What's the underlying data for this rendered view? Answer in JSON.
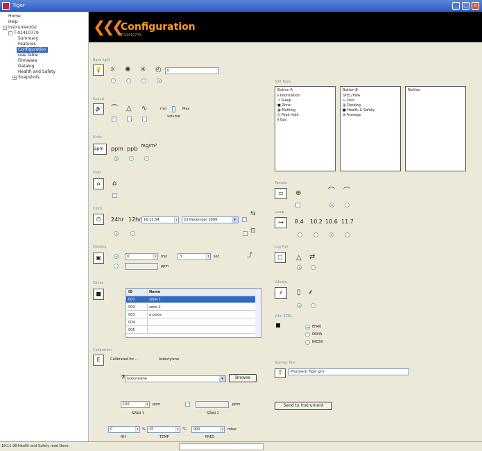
{
  "window": {
    "title": "Tiger",
    "min": "_",
    "max": "□",
    "close": "×"
  },
  "tree": {
    "home": "Home",
    "help": "Help",
    "instruments": "Instrument(s)",
    "instrument": "T-01410779",
    "items": [
      "Summary",
      "Features",
      "Configuration",
      "Gas Table",
      "Firmware",
      "Datalog",
      "Health and Safety",
      "Snapshots"
    ]
  },
  "header": {
    "title": "Configuration",
    "subtitle": "T-01410779"
  },
  "backlight": {
    "label": "Back light",
    "timeout": "0",
    "radios": [
      false,
      false,
      false,
      true
    ]
  },
  "sound": {
    "label": "Sound",
    "checks": [
      true,
      false,
      false
    ],
    "min": "min",
    "max": "Max",
    "volume": "volume"
  },
  "units": {
    "label": "Units",
    "options": [
      "ppm",
      "ppm",
      "ppb",
      "mg/m³"
    ],
    "radios": [
      true,
      false,
      false
    ]
  },
  "hold": {
    "label": "Hold"
  },
  "clock": {
    "label": "Clock",
    "h24": "24hr",
    "h12": "12hr",
    "time": "16:11:54",
    "date": "23 December 2009",
    "radios": [
      true,
      false
    ]
  },
  "datalog": {
    "label": "Datalog",
    "value": "0",
    "min": "min",
    "sec_value": "3",
    "sec": "sec",
    "ppm": "ppm"
  },
  "zones": {
    "label": "Zones",
    "col_id": "ID",
    "col_name": "Name",
    "rows": [
      {
        "id": "001",
        "name": "zone 1"
      },
      {
        "id": "002",
        "name": "zone 2"
      },
      {
        "id": "003",
        "name": "a place"
      },
      {
        "id": "004",
        "name": ""
      },
      {
        "id": "005",
        "name": ""
      }
    ]
  },
  "calibration": {
    "label": "Calibration",
    "calibrated_for": "Calibrated for ...",
    "gas": "Isobutylene",
    "gas_select": "Isobutylene",
    "browse": "Browse",
    "span1": "100",
    "span1_unit": "ppm",
    "span1_label": "SPAN 1",
    "span2_unit": "ppm",
    "span2_label": "SPAN 2",
    "rh": "0",
    "rh_unit": "%",
    "rh_label": "RH",
    "temp": "25",
    "temp_unit": "°C",
    "temp_label": "TEMP",
    "pres": "900",
    "pres_unit": "mbar",
    "pres_label": "PRES"
  },
  "softkeys": {
    "label": "Soft Keys",
    "col_a": "Button A",
    "col_b": "Button B",
    "col_n": "Neither",
    "a_items": [
      "Information",
      "Sleep",
      "Zone",
      "Multilog",
      "Peak Hold",
      "Gas"
    ],
    "b_items": [
      "STEL/TWA",
      "Zero",
      "Datalog",
      "Health & Safety",
      "Average"
    ]
  },
  "tamper": {
    "label": "Tamper",
    "radios": [
      true,
      false
    ]
  },
  "lamp": {
    "label": "Lamp",
    "values": [
      "8.4",
      "10.2",
      "10.6",
      "11.7"
    ],
    "radios": [
      false,
      false,
      true,
      false
    ]
  },
  "logfull": {
    "label": "Log Full",
    "radios": [
      true,
      false
    ]
  },
  "vibrate": {
    "label": "Vibrate",
    "radios": [
      true,
      false
    ]
  },
  "voc": {
    "label": "Vibr. STEL",
    "options": [
      "EH40",
      "OSHA",
      "NIOSH"
    ],
    "radios": [
      true,
      false,
      false
    ]
  },
  "startup": {
    "label": "Startup Text",
    "value": "Phocheck Tiger grrr"
  },
  "send": {
    "label": "Send to instrument"
  },
  "status": {
    "text": "16:11:38 Health and Safety read Done."
  }
}
